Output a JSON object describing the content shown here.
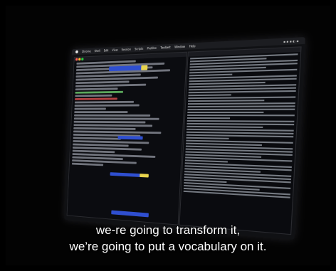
{
  "caption": {
    "line1": "we-re going to transform it,",
    "line2": "we’re going to put a vocabulary on it."
  },
  "screen": {
    "menubar_items": [
      "Chrome",
      "Shell",
      "Edit",
      "View",
      "Session",
      "Scripts",
      "Profiles",
      "Toolbelt",
      "Window",
      "Help"
    ]
  },
  "colors": {
    "background": "#000000",
    "caption_text": "#ffffff",
    "highlight_blue": "#2f4fd0",
    "highlight_yellow": "#e8d44d"
  }
}
